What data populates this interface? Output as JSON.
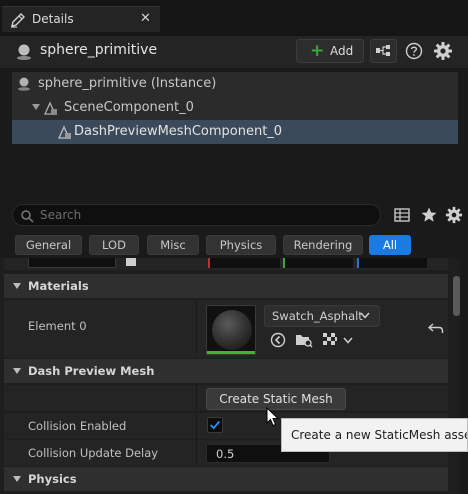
{
  "tab": {
    "title": "Details",
    "close_glyph": "✕",
    "icon": "details-pencil-icon"
  },
  "header": {
    "actor_name": "sphere_primitive",
    "add_label": "Add",
    "add_glyph": "+",
    "icons": [
      "actor-sphere-icon",
      "blueprint-icon",
      "help-icon",
      "settings-gear-icon"
    ]
  },
  "tree": {
    "items": [
      {
        "label": "sphere_primitive (Instance)"
      },
      {
        "label": "SceneComponent_0"
      },
      {
        "label": "DashPreviewMeshComponent_0",
        "selected": true
      }
    ]
  },
  "search": {
    "placeholder": "Search"
  },
  "filters": [
    {
      "label": "General"
    },
    {
      "label": "LOD"
    },
    {
      "label": "Misc"
    },
    {
      "label": "Physics"
    },
    {
      "label": "Rendering"
    },
    {
      "label": "All",
      "active": true
    }
  ],
  "sections": {
    "materials": "Materials",
    "dash_preview_mesh": "Dash Preview Mesh",
    "physics": "Physics"
  },
  "properties": {
    "element0": {
      "label": "Element 0",
      "material": "Swatch_Asphalt"
    },
    "create_static_mesh_label": "Create Static Mesh",
    "collision_enabled": {
      "label": "Collision Enabled",
      "checked": true
    },
    "collision_update_delay": {
      "label": "Collision Update Delay",
      "value": "0.5"
    }
  },
  "tooltip": {
    "text": "Create a new StaticMesh asset from"
  },
  "colors": {
    "accent": "#1a7be3",
    "add_plus": "#3aa83a",
    "selection": "#3b4a5a",
    "thumb_bar": "#3db33d"
  }
}
